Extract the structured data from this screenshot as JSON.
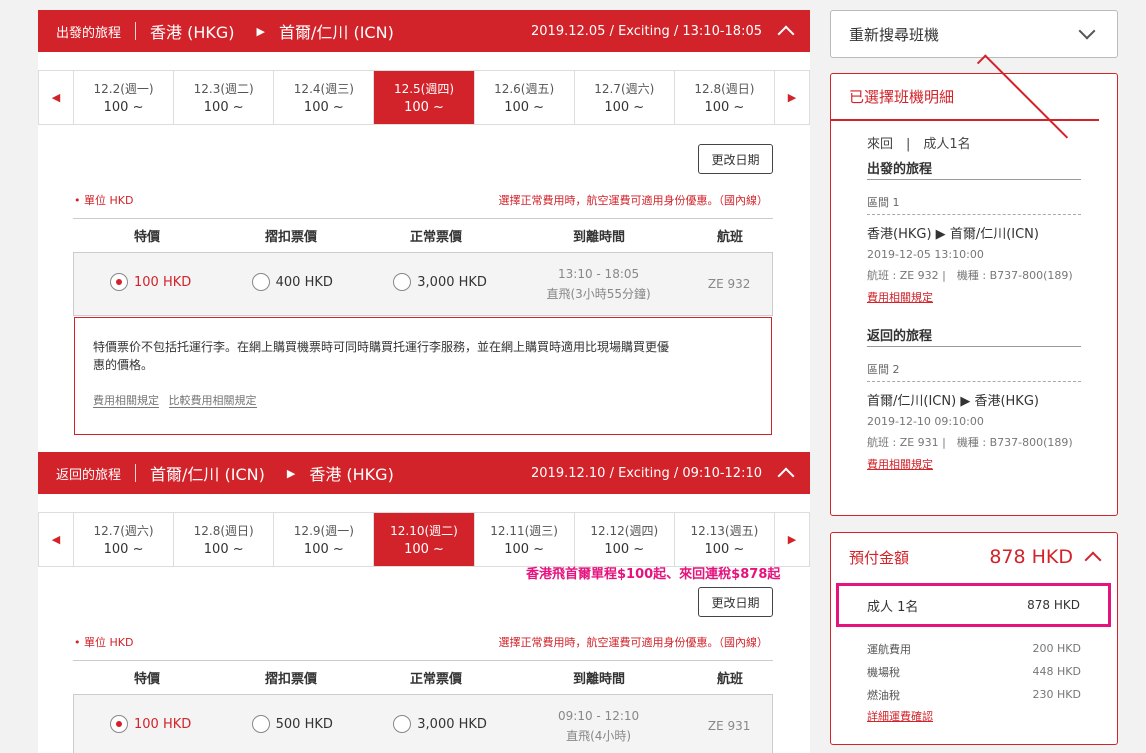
{
  "outbound": {
    "label": "出發的旅程",
    "from": "香港 (HKG)",
    "to": "首爾/仁川 (ICN)",
    "info": "2019.12.05 / Exciting / 13:10-18:05",
    "dates": [
      {
        "date": "12.2(週一)",
        "price": "100 ~"
      },
      {
        "date": "12.3(週二)",
        "price": "100 ~"
      },
      {
        "date": "12.4(週三)",
        "price": "100 ~"
      },
      {
        "date": "12.5(週四)",
        "price": "100 ~"
      },
      {
        "date": "12.6(週五)",
        "price": "100 ~"
      },
      {
        "date": "12.7(週六)",
        "price": "100 ~"
      },
      {
        "date": "12.8(週日)",
        "price": "100 ~"
      }
    ],
    "change_label": "更改日期",
    "unit": "• 單位 HKD",
    "note": "選擇正常費用時，航空運費可適用身份優惠。（國內線）",
    "headers": [
      "特價",
      "摺扣票價",
      "正常票價",
      "到離時間",
      "航班"
    ],
    "fares": [
      "100 HKD",
      "400 HKD",
      "3,000 HKD"
    ],
    "time": "13:10 - 18:05",
    "duration": "直飛(3小時55分鐘)",
    "flight": "ZE 932",
    "detail_text": "特價票价不包括托運行李。在網上購買機票時可同時購買托運行李服務，並在網上購買時適用比現場購買更優惠的價格。",
    "link1": "費用相關規定",
    "link2": "比較費用相關規定"
  },
  "inbound": {
    "label": "返回的旅程",
    "from": "首爾/仁川 (ICN)",
    "to": "香港 (HKG)",
    "info": "2019.12.10 / Exciting / 09:10-12:10",
    "dates": [
      {
        "date": "12.7(週六)",
        "price": "100 ~"
      },
      {
        "date": "12.8(週日)",
        "price": "100 ~"
      },
      {
        "date": "12.9(週一)",
        "price": "100 ~"
      },
      {
        "date": "12.10(週二)",
        "price": "100 ~"
      },
      {
        "date": "12.11(週三)",
        "price": "100 ~"
      },
      {
        "date": "12.12(週四)",
        "price": "100 ~"
      },
      {
        "date": "12.13(週五)",
        "price": "100 ~"
      }
    ],
    "change_label": "更改日期",
    "unit": "• 單位 HKD",
    "note": "選擇正常費用時，航空運費可適用身份優惠。（國內線）",
    "headers": [
      "特價",
      "摺扣票價",
      "正常票價",
      "到離時間",
      "航班"
    ],
    "fares": [
      "100 HKD",
      "500 HKD",
      "3,000 HKD"
    ],
    "time": "09:10 - 12:10",
    "duration": "直飛(4小時)",
    "flight": "ZE 931"
  },
  "promo": "香港飛首爾單程$100起、來回連稅$878起",
  "sidebar": {
    "search_label": "重新搜尋班機",
    "detail_title": "已選擇班機明細",
    "trip_type": "來回　|　成人1名",
    "out_title": "出發的旅程",
    "out_section": "區間 1",
    "out_from": "香港(HKG)",
    "out_to": "首爾/仁川(ICN)",
    "out_datetime": "2019-12-05 13:10:00",
    "out_flight": "航班 : ZE 932 |　機種 : B737-800(189)",
    "out_link": "費用相關規定",
    "in_title": "返回的旅程",
    "in_section": "區間 2",
    "in_from": "首爾/仁川(ICN)",
    "in_to": "香港(HKG)",
    "in_datetime": "2019-12-10 09:10:00",
    "in_flight": "航班 : ZE 931 |　機種 : B737-800(189)",
    "in_link": "費用相關規定",
    "pay_title": "預付金額",
    "pay_amount": "878 HKD",
    "adult_label": "成人 1名",
    "adult_amount": "878 HKD",
    "fees": [
      {
        "label": "運航費用",
        "value": "200 HKD"
      },
      {
        "label": "機場稅",
        "value": "448 HKD"
      },
      {
        "label": "燃油稅",
        "value": "230 HKD"
      }
    ],
    "fee_link": "詳細運費確認"
  },
  "colors": {
    "accent": "#d2232a",
    "highlight": "#e6127d"
  }
}
